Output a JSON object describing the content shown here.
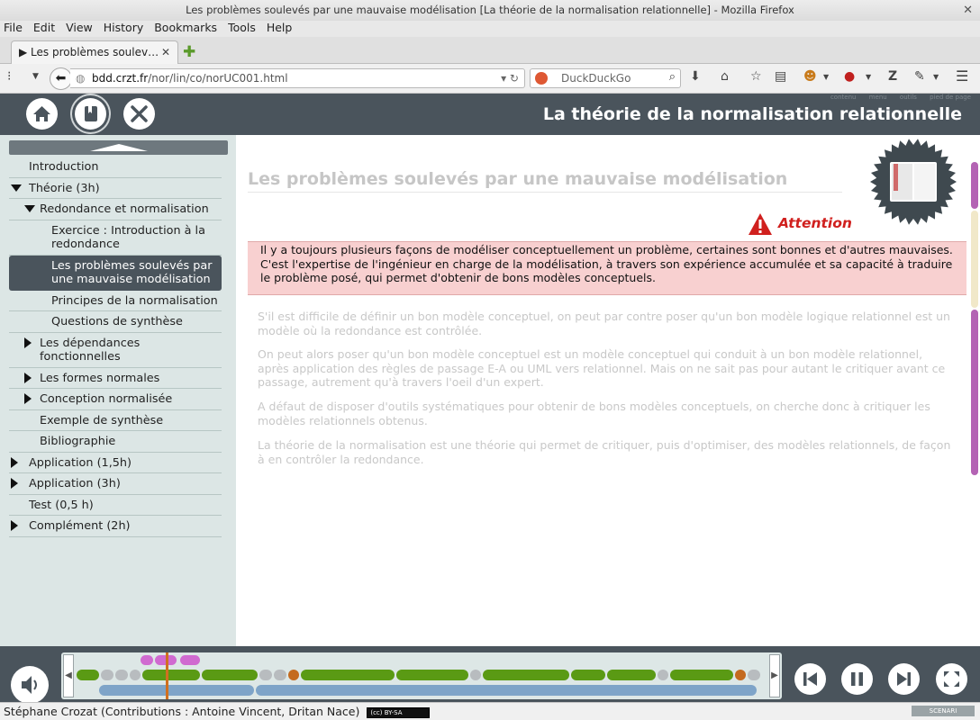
{
  "browser": {
    "window_title": "Les problèmes soulevés par une mauvaise modélisation [La théorie de la normalisation relationnelle] - Mozilla Firefox",
    "menu": [
      "File",
      "Edit",
      "View",
      "History",
      "Bookmarks",
      "Tools",
      "Help"
    ],
    "tab_title": "Les problèmes soulev…",
    "url_host": "bdd.crzt.fr",
    "url_path": "/nor/lin/co/norUC001.html",
    "search_placeholder": "DuckDuckGo"
  },
  "header": {
    "title": "La théorie de la normalisation relationnelle",
    "help_links": [
      "contenu",
      "menu",
      "outils",
      "pied de page"
    ],
    "buttons": [
      "home-icon",
      "book-icon",
      "tools-icon"
    ]
  },
  "nav": {
    "items": [
      {
        "label": "Introduction",
        "level": 0,
        "arrow": "none",
        "selected": false
      },
      {
        "label": "Théorie (3h)",
        "level": 0,
        "arrow": "open",
        "selected": false
      },
      {
        "label": "Redondance et normalisation",
        "level": 1,
        "arrow": "open",
        "selected": false
      },
      {
        "label": "Exercice : Introduction à la redondance",
        "level": 2,
        "arrow": "none",
        "selected": false
      },
      {
        "label": "Les problèmes soulevés par une mauvaise modélisation",
        "level": 2,
        "arrow": "none",
        "selected": true
      },
      {
        "label": "Principes de la normalisation",
        "level": 2,
        "arrow": "none",
        "selected": false
      },
      {
        "label": "Questions de synthèse",
        "level": 2,
        "arrow": "none",
        "selected": false
      },
      {
        "label": "Les dépendances fonctionnelles",
        "level": 1,
        "arrow": "closed",
        "selected": false
      },
      {
        "label": "Les formes normales",
        "level": 1,
        "arrow": "closed",
        "selected": false
      },
      {
        "label": "Conception normalisée",
        "level": 1,
        "arrow": "closed",
        "selected": false
      },
      {
        "label": "Exemple de synthèse",
        "level": 1,
        "arrow": "none",
        "selected": false
      },
      {
        "label": "Bibliographie",
        "level": 1,
        "arrow": "none",
        "selected": false
      },
      {
        "label": "Application (1,5h)",
        "level": 0,
        "arrow": "closed",
        "selected": false
      },
      {
        "label": "Application (3h)",
        "level": 0,
        "arrow": "closed",
        "selected": false
      },
      {
        "label": "Test (0,5 h)",
        "level": 0,
        "arrow": "none",
        "selected": false
      },
      {
        "label": "Complément (2h)",
        "level": 0,
        "arrow": "closed",
        "selected": false
      }
    ]
  },
  "content": {
    "page_title": "Les problèmes soulevés par une mauvaise modélisation",
    "attention_label": "Attention",
    "warning_text": "Il y a toujours plusieurs façons de modéliser conceptuellement un problème, certaines sont bonnes et d'autres mauvaises. C'est l'expertise de l'ingénieur en charge de la modélisation, à travers son expérience accumulée et sa capacité à traduire le problème posé, qui permet d'obtenir de bons modèles conceptuels.",
    "paragraphs": [
      "S'il est difficile de définir un bon modèle conceptuel, on peut par contre poser qu'un bon modèle logique relationnel est un modèle où la redondance est contrôlée.",
      "On peut alors poser qu'un bon modèle conceptuel est un modèle conceptuel qui conduit à un bon modèle relationnel, après application des règles de passage E-A ou UML vers relationnel. Mais on ne sait pas pour autant le critiquer avant ce passage, autrement qu'à travers l'oeil d'un expert.",
      "A défaut de disposer d'outils systématiques pour obtenir de bons modèles conceptuels, on cherche donc à critiquer les modèles relationnels obtenus.",
      "La théorie de la normalisation est une théorie qui permet de critiquer, puis d'optimiser, des modèles relationnels, de façon à en contrôler la redondance."
    ]
  },
  "player": {
    "buttons": [
      "sound-icon",
      "previous-icon",
      "pause-icon",
      "next-icon",
      "fullscreen-icon"
    ],
    "colors": {
      "green": "#5a9a14",
      "grey": "#b8bcbf",
      "orange": "#c46a1f",
      "pink": "#d06ad0",
      "blue": "#7ea4c8",
      "cursor": "#d07020"
    }
  },
  "footer": {
    "credits": "Stéphane Crozat (Contributions : Antoine Vincent, Dritan Nace)",
    "license": "BY-SA",
    "brand": "SCENARI"
  }
}
